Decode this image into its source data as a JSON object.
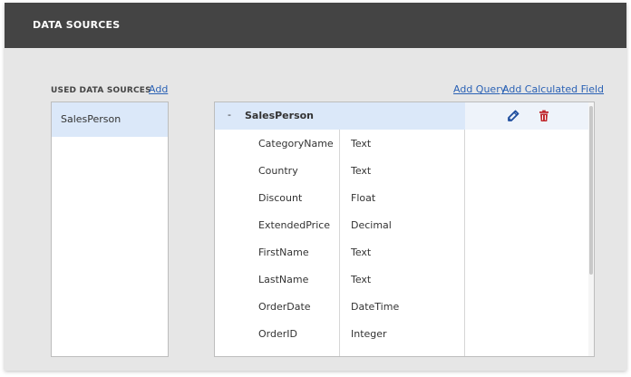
{
  "header": {
    "title": "DATA SOURCES"
  },
  "used_sources": {
    "label": "USED DATA SOURCES",
    "add_label": "Add",
    "items": [
      {
        "label": "SalesPerson",
        "selected": true
      }
    ]
  },
  "toolbar": {
    "add_query_label": "Add Query",
    "add_calculated_field_label": "Add Calculated Field"
  },
  "fields_panel": {
    "group": {
      "toggle": "-",
      "name": "SalesPerson"
    },
    "fields": [
      {
        "name": "CategoryName",
        "type": "Text"
      },
      {
        "name": "Country",
        "type": "Text"
      },
      {
        "name": "Discount",
        "type": "Float"
      },
      {
        "name": "ExtendedPrice",
        "type": "Decimal"
      },
      {
        "name": "FirstName",
        "type": "Text"
      },
      {
        "name": "LastName",
        "type": "Text"
      },
      {
        "name": "OrderDate",
        "type": "DateTime"
      },
      {
        "name": "OrderID",
        "type": "Integer"
      }
    ]
  },
  "icons": {
    "edit": "pencil-icon",
    "delete": "trash-icon"
  },
  "colors": {
    "header_bg": "#444444",
    "panel_bg": "#e6e6e6",
    "selection": "#dbe8f9",
    "link": "#2b62b5",
    "edit_icon": "#1f4e9e",
    "delete_icon": "#c0282d"
  }
}
